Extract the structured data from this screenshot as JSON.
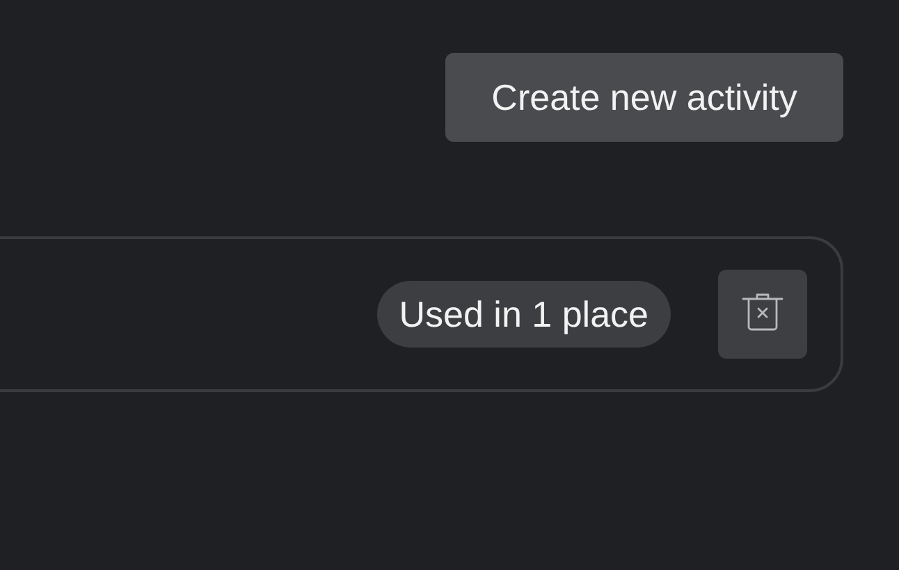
{
  "create_button": {
    "label": "Create new activity"
  },
  "activity": {
    "usage_badge": "Used in 1 place"
  }
}
